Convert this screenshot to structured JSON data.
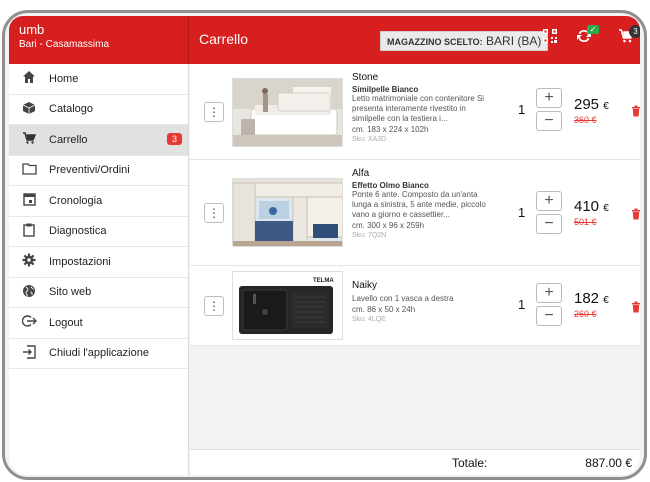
{
  "user": {
    "name": "umb",
    "location": "Bari - Casamassima"
  },
  "header": {
    "title": "Carrello",
    "warehouse_label": "MAGAZZINO SCELTO:",
    "warehouse_value": "BARI (BA)",
    "cart_count": "3",
    "sync_status": "✓"
  },
  "sidebar": {
    "items": [
      {
        "label": "Home",
        "icon": "home-icon"
      },
      {
        "label": "Catalogo",
        "icon": "cube-icon"
      },
      {
        "label": "Carrello",
        "icon": "cart-icon",
        "badge": "3",
        "active": true
      },
      {
        "label": "Preventivi/Ordini",
        "icon": "folder-icon"
      },
      {
        "label": "Cronologia",
        "icon": "calendar-icon"
      },
      {
        "label": "Diagnostica",
        "icon": "clipboard-icon"
      },
      {
        "label": "Impostazioni",
        "icon": "gear-icon"
      },
      {
        "label": "Sito web",
        "icon": "globe-icon"
      },
      {
        "label": "Logout",
        "icon": "logout-icon"
      },
      {
        "label": "Chiudi l'applicazione",
        "icon": "exit-icon"
      }
    ]
  },
  "cart": {
    "items": [
      {
        "name": "Stone",
        "subtitle": "Similpelle Bianco",
        "description": "Letto matrimoniale con contenitore Si presenta interamente rivestito in similpelle con la testiera i...",
        "dimensions": "cm. 183 x 224 x 102h",
        "sku": "Sku: XA3D",
        "qty": "1",
        "price": "295",
        "old_price": "360 €",
        "currency": "€"
      },
      {
        "name": "Alfa",
        "subtitle": "Effetto Olmo Bianco",
        "description": "Ponte 6 ante. Composto da un'anta lunga a sinistra, 5 ante medie, piccolo vano a giorno e cassettier...",
        "dimensions": "cm. 300 x 96 x 259h",
        "sku": "Sku: 7Q2N",
        "qty": "1",
        "price": "410",
        "old_price": "501 €",
        "currency": "€"
      },
      {
        "name": "Naiky",
        "subtitle": "",
        "description": "Lavello con 1 vasca a destra",
        "dimensions": "cm. 86 x 50 x 24h",
        "sku": "Sku: 4LQE",
        "qty": "1",
        "price": "182",
        "old_price": "260 €",
        "currency": "€"
      }
    ],
    "sink_brand": "TELMA"
  },
  "footer": {
    "total_label": "Totale:",
    "total_value": "887.00 €"
  },
  "colors": {
    "accent": "#d71f1f",
    "badge": "#e53935",
    "sync_ok": "#2ea84a"
  }
}
